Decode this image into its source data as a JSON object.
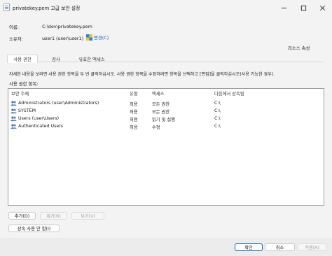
{
  "window": {
    "title": "privatekey.pem 고급 보안 설정",
    "minimize_icon": "minimize-icon",
    "maximize_icon": "maximize-icon",
    "close_icon": "close-icon"
  },
  "info": {
    "name_label": "이름:",
    "name_value": "C:\\dev\\privatekey.pem",
    "owner_label": "소유자:",
    "owner_value": "user1 (user\\user1)",
    "change_label": "변경(C)",
    "resource_properties": "리소스 속성"
  },
  "tabs": [
    {
      "label": "사용 권한",
      "active": true
    },
    {
      "label": "감사",
      "active": false
    },
    {
      "label": "유효한 액세스",
      "active": false
    }
  ],
  "instructions": "자세한 내용을 보려면 사용 권한 항목을 두 번 클릭하십시오. 사용 권한 항목을 수정하려면 항목을 선택하고 [편집]을 클릭하십시오(사용 가능한 경우).",
  "list_label": "사용 권한 항목:",
  "table": {
    "headers": [
      "보안 주체",
      "유형",
      "액세스",
      "다음에서 상속됨"
    ],
    "rows": [
      [
        "Administrators (user\\Administrators)",
        "허용",
        "모든 권한",
        "C:\\"
      ],
      [
        "SYSTEM",
        "허용",
        "모든 권한",
        "C:\\"
      ],
      [
        "Users (user\\Users)",
        "허용",
        "읽기 및 실행",
        "C:\\"
      ],
      [
        "Authenticated Users",
        "허용",
        "수정",
        "C:\\"
      ]
    ]
  },
  "buttons": {
    "add": "추가(D)",
    "remove": "제거(R)",
    "view": "보기(V)",
    "disable_inheritance": "상속 사용 안 함(I)",
    "ok": "확인",
    "cancel": "취소",
    "apply": "적용(A)"
  },
  "colors": {
    "link": "#1a5fb4",
    "primary_border": "#0a64c9"
  }
}
